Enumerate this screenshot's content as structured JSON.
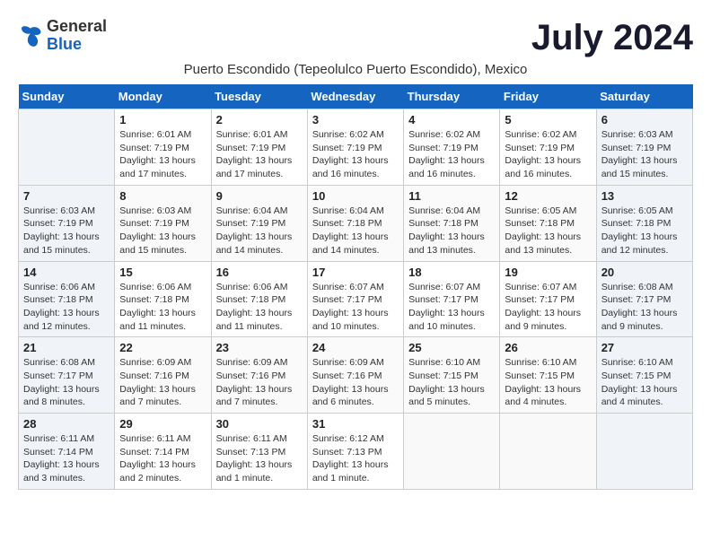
{
  "header": {
    "logo_general": "General",
    "logo_blue": "Blue",
    "month_year": "July 2024",
    "subtitle": "Puerto Escondido (Tepeolulco Puerto Escondido), Mexico"
  },
  "days_of_week": [
    "Sunday",
    "Monday",
    "Tuesday",
    "Wednesday",
    "Thursday",
    "Friday",
    "Saturday"
  ],
  "weeks": [
    [
      {
        "day": "",
        "sunrise": "",
        "sunset": "",
        "daylight": ""
      },
      {
        "day": "1",
        "sunrise": "6:01 AM",
        "sunset": "7:19 PM",
        "daylight": "13 hours and 17 minutes."
      },
      {
        "day": "2",
        "sunrise": "6:01 AM",
        "sunset": "7:19 PM",
        "daylight": "13 hours and 17 minutes."
      },
      {
        "day": "3",
        "sunrise": "6:02 AM",
        "sunset": "7:19 PM",
        "daylight": "13 hours and 16 minutes."
      },
      {
        "day": "4",
        "sunrise": "6:02 AM",
        "sunset": "7:19 PM",
        "daylight": "13 hours and 16 minutes."
      },
      {
        "day": "5",
        "sunrise": "6:02 AM",
        "sunset": "7:19 PM",
        "daylight": "13 hours and 16 minutes."
      },
      {
        "day": "6",
        "sunrise": "6:03 AM",
        "sunset": "7:19 PM",
        "daylight": "13 hours and 15 minutes."
      }
    ],
    [
      {
        "day": "7",
        "sunrise": "6:03 AM",
        "sunset": "7:19 PM",
        "daylight": "13 hours and 15 minutes."
      },
      {
        "day": "8",
        "sunrise": "6:03 AM",
        "sunset": "7:19 PM",
        "daylight": "13 hours and 15 minutes."
      },
      {
        "day": "9",
        "sunrise": "6:04 AM",
        "sunset": "7:19 PM",
        "daylight": "13 hours and 14 minutes."
      },
      {
        "day": "10",
        "sunrise": "6:04 AM",
        "sunset": "7:18 PM",
        "daylight": "13 hours and 14 minutes."
      },
      {
        "day": "11",
        "sunrise": "6:04 AM",
        "sunset": "7:18 PM",
        "daylight": "13 hours and 13 minutes."
      },
      {
        "day": "12",
        "sunrise": "6:05 AM",
        "sunset": "7:18 PM",
        "daylight": "13 hours and 13 minutes."
      },
      {
        "day": "13",
        "sunrise": "6:05 AM",
        "sunset": "7:18 PM",
        "daylight": "13 hours and 12 minutes."
      }
    ],
    [
      {
        "day": "14",
        "sunrise": "6:06 AM",
        "sunset": "7:18 PM",
        "daylight": "13 hours and 12 minutes."
      },
      {
        "day": "15",
        "sunrise": "6:06 AM",
        "sunset": "7:18 PM",
        "daylight": "13 hours and 11 minutes."
      },
      {
        "day": "16",
        "sunrise": "6:06 AM",
        "sunset": "7:18 PM",
        "daylight": "13 hours and 11 minutes."
      },
      {
        "day": "17",
        "sunrise": "6:07 AM",
        "sunset": "7:17 PM",
        "daylight": "13 hours and 10 minutes."
      },
      {
        "day": "18",
        "sunrise": "6:07 AM",
        "sunset": "7:17 PM",
        "daylight": "13 hours and 10 minutes."
      },
      {
        "day": "19",
        "sunrise": "6:07 AM",
        "sunset": "7:17 PM",
        "daylight": "13 hours and 9 minutes."
      },
      {
        "day": "20",
        "sunrise": "6:08 AM",
        "sunset": "7:17 PM",
        "daylight": "13 hours and 9 minutes."
      }
    ],
    [
      {
        "day": "21",
        "sunrise": "6:08 AM",
        "sunset": "7:17 PM",
        "daylight": "13 hours and 8 minutes."
      },
      {
        "day": "22",
        "sunrise": "6:09 AM",
        "sunset": "7:16 PM",
        "daylight": "13 hours and 7 minutes."
      },
      {
        "day": "23",
        "sunrise": "6:09 AM",
        "sunset": "7:16 PM",
        "daylight": "13 hours and 7 minutes."
      },
      {
        "day": "24",
        "sunrise": "6:09 AM",
        "sunset": "7:16 PM",
        "daylight": "13 hours and 6 minutes."
      },
      {
        "day": "25",
        "sunrise": "6:10 AM",
        "sunset": "7:15 PM",
        "daylight": "13 hours and 5 minutes."
      },
      {
        "day": "26",
        "sunrise": "6:10 AM",
        "sunset": "7:15 PM",
        "daylight": "13 hours and 4 minutes."
      },
      {
        "day": "27",
        "sunrise": "6:10 AM",
        "sunset": "7:15 PM",
        "daylight": "13 hours and 4 minutes."
      }
    ],
    [
      {
        "day": "28",
        "sunrise": "6:11 AM",
        "sunset": "7:14 PM",
        "daylight": "13 hours and 3 minutes."
      },
      {
        "day": "29",
        "sunrise": "6:11 AM",
        "sunset": "7:14 PM",
        "daylight": "13 hours and 2 minutes."
      },
      {
        "day": "30",
        "sunrise": "6:11 AM",
        "sunset": "7:13 PM",
        "daylight": "13 hours and 1 minute."
      },
      {
        "day": "31",
        "sunrise": "6:12 AM",
        "sunset": "7:13 PM",
        "daylight": "13 hours and 1 minute."
      },
      {
        "day": "",
        "sunrise": "",
        "sunset": "",
        "daylight": ""
      },
      {
        "day": "",
        "sunrise": "",
        "sunset": "",
        "daylight": ""
      },
      {
        "day": "",
        "sunrise": "",
        "sunset": "",
        "daylight": ""
      }
    ]
  ]
}
